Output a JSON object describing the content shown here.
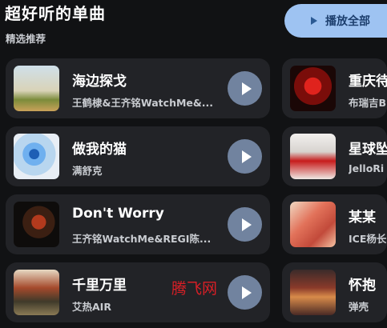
{
  "header": {
    "title": "超好听的单曲",
    "subtitle": "精选推荐",
    "play_all_label": "播放全部"
  },
  "songs_left": [
    {
      "title": "海边探戈",
      "artist": "王鹤棣&王齐铭WatchMe&..."
    },
    {
      "title": "做我的猫",
      "artist": "满舒克"
    },
    {
      "title": "Don't Worry",
      "artist": "王齐铭WatchMe&REGI陈..."
    },
    {
      "title": "千里万里",
      "artist": "艾热AIR"
    }
  ],
  "songs_right": [
    {
      "title": "重庆待",
      "artist": "布瑞吉B"
    },
    {
      "title": "星球坠",
      "artist": "JelloRi"
    },
    {
      "title": "某某",
      "artist": "ICE杨长"
    },
    {
      "title": "怀抱",
      "artist": "弹壳"
    }
  ],
  "watermark": "腾飞网",
  "icons": {
    "play_all": "play-icon",
    "row_play": "play-circle-icon"
  },
  "colors": {
    "background": "#111214",
    "card": "#222327",
    "play_all_button": "#9ec3f2",
    "row_play_button": "#71839f",
    "watermark": "#d81f26"
  }
}
